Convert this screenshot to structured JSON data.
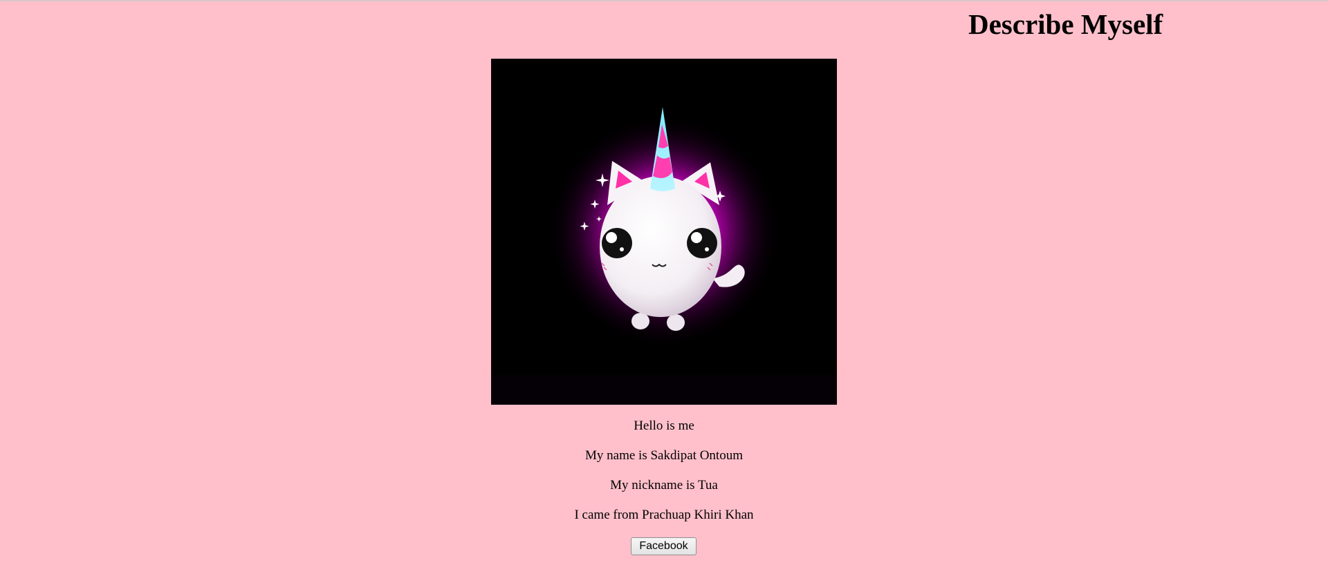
{
  "page": {
    "title": "Describe Myself",
    "background_color": "#ffc0cb"
  },
  "profile_image": {
    "subject": "unicorn-cat-icon"
  },
  "intro": {
    "lines": [
      "Hello is me",
      "My name is Sakdipat Ontoum",
      "My nickname is Tua",
      "I came from Prachuap Khiri Khan"
    ]
  },
  "facebook_button": {
    "label": "Facebook"
  }
}
